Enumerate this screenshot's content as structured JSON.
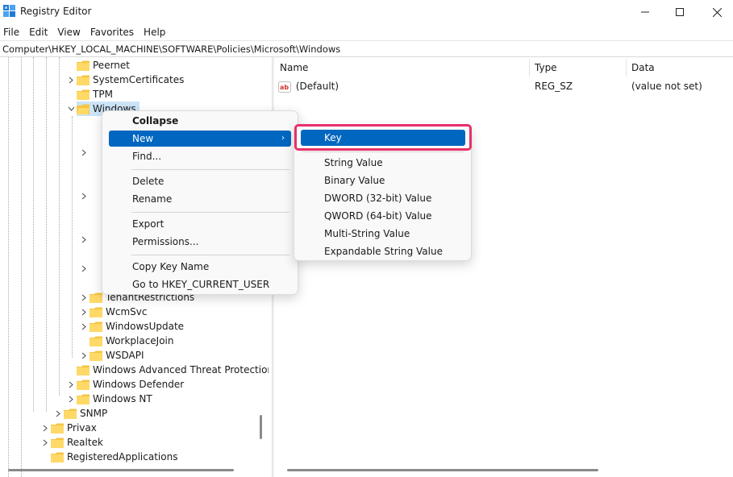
{
  "window": {
    "title": "Registry Editor",
    "minimize": "minimize",
    "maximize": "maximize",
    "close": "close"
  },
  "menubar": [
    "File",
    "Edit",
    "View",
    "Favorites",
    "Help"
  ],
  "address": "Computer\\HKEY_LOCAL_MACHINE\\SOFTWARE\\Policies\\Microsoft\\Windows",
  "tree": {
    "top_items": [
      {
        "label": "Peernet",
        "expandable": false
      },
      {
        "label": "SystemCertificates",
        "expandable": true
      },
      {
        "label": "TPM",
        "expandable": false
      },
      {
        "label": "Windows",
        "expandable": true,
        "expanded": true,
        "selected": true
      }
    ],
    "windows_children": [
      {
        "label": "TenantRestrictions",
        "expandable": true
      },
      {
        "label": "WcmSvc",
        "expandable": true
      },
      {
        "label": "WindowsUpdate",
        "expandable": true
      },
      {
        "label": "WorkplaceJoin",
        "expandable": false
      },
      {
        "label": "WSDAPI",
        "expandable": true
      }
    ],
    "microsoft_tail": [
      {
        "label": "Windows Advanced Threat Protection",
        "expandable": false
      },
      {
        "label": "Windows Defender",
        "expandable": true
      },
      {
        "label": "Windows NT",
        "expandable": true
      }
    ],
    "policies_tail": [
      {
        "label": "SNMP",
        "expandable": true
      }
    ],
    "software_tail": [
      {
        "label": "Privax",
        "expandable": true
      },
      {
        "label": "Realtek",
        "expandable": true
      },
      {
        "label": "RegisteredApplications",
        "expandable": false
      }
    ]
  },
  "values": {
    "columns": [
      "Name",
      "Type",
      "Data"
    ],
    "rows": [
      {
        "name": "(Default)",
        "type": "REG_SZ",
        "data": "(value not set)",
        "icon": "string-value-icon"
      }
    ]
  },
  "context_menu": {
    "items": [
      {
        "label": "Collapse",
        "bold": true
      },
      {
        "label": "New",
        "submenu": true,
        "active": true
      },
      {
        "label": "Find..."
      },
      {
        "separator": true
      },
      {
        "label": "Delete"
      },
      {
        "label": "Rename"
      },
      {
        "separator": true
      },
      {
        "label": "Export"
      },
      {
        "label": "Permissions..."
      },
      {
        "separator": true
      },
      {
        "label": "Copy Key Name"
      },
      {
        "label": "Go to HKEY_CURRENT_USER"
      }
    ],
    "submenu_arrow": "›"
  },
  "submenu": {
    "items": [
      {
        "label": "Key",
        "active": true
      },
      {
        "separator": true
      },
      {
        "label": "String Value"
      },
      {
        "label": "Binary Value"
      },
      {
        "label": "DWORD (32-bit) Value"
      },
      {
        "label": "QWORD (64-bit) Value"
      },
      {
        "label": "Multi-String Value"
      },
      {
        "label": "Expandable String Value"
      }
    ]
  },
  "colors": {
    "accent": "#0067c0",
    "highlight": "#e8306a",
    "folder": "#f5c542"
  }
}
